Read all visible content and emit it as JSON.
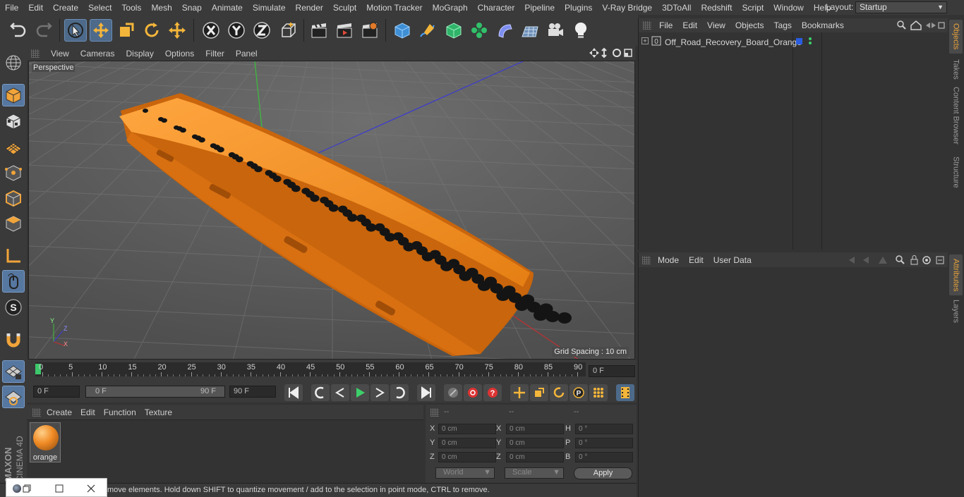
{
  "menubar": {
    "items": [
      "File",
      "Edit",
      "Create",
      "Select",
      "Tools",
      "Mesh",
      "Snap",
      "Animate",
      "Simulate",
      "Render",
      "Sculpt",
      "Motion Tracker",
      "MoGraph",
      "Character",
      "Pipeline",
      "Plugins",
      "V-Ray Bridge",
      "3DToAll",
      "Redshift",
      "Script",
      "Window",
      "Help"
    ],
    "layout_label": "Layout:",
    "layout_value": "Startup"
  },
  "viewport": {
    "menu": [
      "View",
      "Cameras",
      "Display",
      "Options",
      "Filter",
      "Panel"
    ],
    "camera_label": "Perspective",
    "grid_spacing": "Grid Spacing : 10 cm"
  },
  "timeline": {
    "ticks": [
      "0",
      "5",
      "10",
      "15",
      "20",
      "25",
      "30",
      "35",
      "40",
      "45",
      "50",
      "55",
      "60",
      "65",
      "70",
      "75",
      "80",
      "85",
      "90"
    ],
    "current_frame": "0 F"
  },
  "transport": {
    "start_field": "0 F",
    "range_start": "0 F",
    "range_end": "90 F",
    "end_field": "90 F"
  },
  "material_manager": {
    "menu": [
      "Create",
      "Edit",
      "Function",
      "Texture"
    ],
    "materials": [
      {
        "name": "orange"
      }
    ]
  },
  "coordinates": {
    "headers": [
      "--",
      "--",
      "--"
    ],
    "rows": [
      {
        "l1": "X",
        "v1": "0 cm",
        "l2": "X",
        "v2": "0 cm",
        "l3": "H",
        "v3": "0 °"
      },
      {
        "l1": "Y",
        "v1": "0 cm",
        "l2": "Y",
        "v2": "0 cm",
        "l3": "P",
        "v3": "0 °"
      },
      {
        "l1": "Z",
        "v1": "0 cm",
        "l2": "Z",
        "v2": "0 cm",
        "l3": "B",
        "v3": "0 °"
      }
    ],
    "space": "World",
    "mode": "Scale",
    "apply": "Apply"
  },
  "status": {
    "text": "move elements. Hold down SHIFT to quantize movement / add to the selection in point mode, CTRL to remove."
  },
  "object_manager": {
    "menu": [
      "File",
      "Edit",
      "View",
      "Objects",
      "Tags",
      "Bookmarks"
    ],
    "objects": [
      {
        "name": "Off_Road_Recovery_Board_Orange"
      }
    ]
  },
  "attribute_manager": {
    "menu": [
      "Mode",
      "Edit",
      "User Data"
    ]
  },
  "side_tabs": [
    "Objects",
    "Takes",
    "Content Browser",
    "Structure"
  ],
  "side_tabs_lower": [
    "Attributes",
    "Layers"
  ],
  "branding": {
    "maxon": "MAXON",
    "product": "CINEMA 4D"
  },
  "colors": {
    "accent": "#5677a0",
    "board": "#f08a24",
    "active_tab": "#e8a33a"
  }
}
